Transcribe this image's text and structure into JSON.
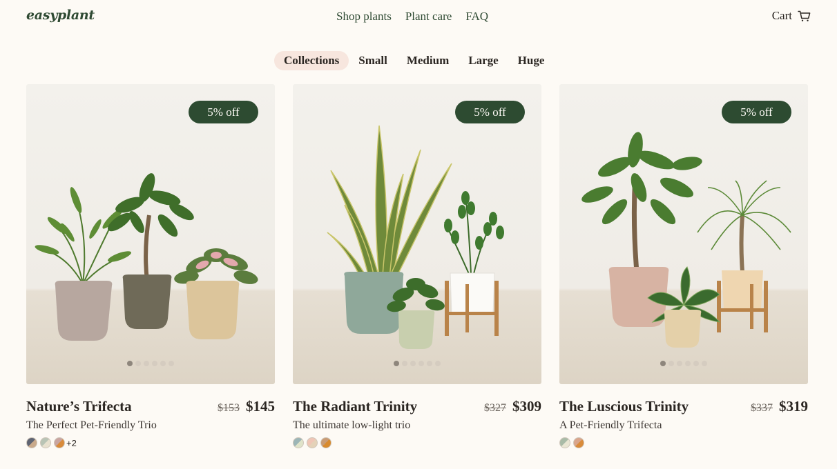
{
  "header": {
    "logo": "easyplant",
    "nav": [
      "Shop plants",
      "Plant care",
      "FAQ"
    ],
    "cart_label": "Cart",
    "cart_icon": "cart-icon"
  },
  "tabs": [
    "Collections",
    "Small",
    "Medium",
    "Large",
    "Huge"
  ],
  "active_tab": "Collections",
  "products": [
    {
      "badge": "5% off",
      "name": "Nature’s Trifecta",
      "old_price": "$153",
      "price": "$145",
      "subtitle": "The Perfect Pet-Friendly Trio",
      "swatches": [
        [
          "#5f6472",
          "#c9a98a"
        ],
        [
          "#b9c4b5",
          "#e8e1cf"
        ],
        [
          "#c9a5a0",
          "#d98b3a"
        ]
      ],
      "more": "+2",
      "carousel_total": 6,
      "carousel_index": 1
    },
    {
      "badge": "5% off",
      "name": "The Radiant Trinity",
      "old_price": "$327",
      "price": "$309",
      "subtitle": "The ultimate low-light trio",
      "swatches": [
        [
          "#9cb5b6",
          "#dfe3c9"
        ],
        [
          "#efc6b6",
          "#e4d2b8"
        ],
        [
          "#c99b73",
          "#d88a2d"
        ]
      ],
      "more": "",
      "carousel_total": 6,
      "carousel_index": 1
    },
    {
      "badge": "5% off",
      "name": "The Luscious Trinity",
      "old_price": "$337",
      "price": "$319",
      "subtitle": "A Pet-Friendly Trifecta",
      "swatches": [
        [
          "#a9bba7",
          "#e9e6d3"
        ],
        [
          "#d9a58b",
          "#d98b3a"
        ]
      ],
      "more": "",
      "carousel_total": 6,
      "carousel_index": 1
    }
  ],
  "colors": {
    "background": "#fdfaf5",
    "brand_green": "#2d4b31",
    "active_tab": "#f7e6de"
  }
}
